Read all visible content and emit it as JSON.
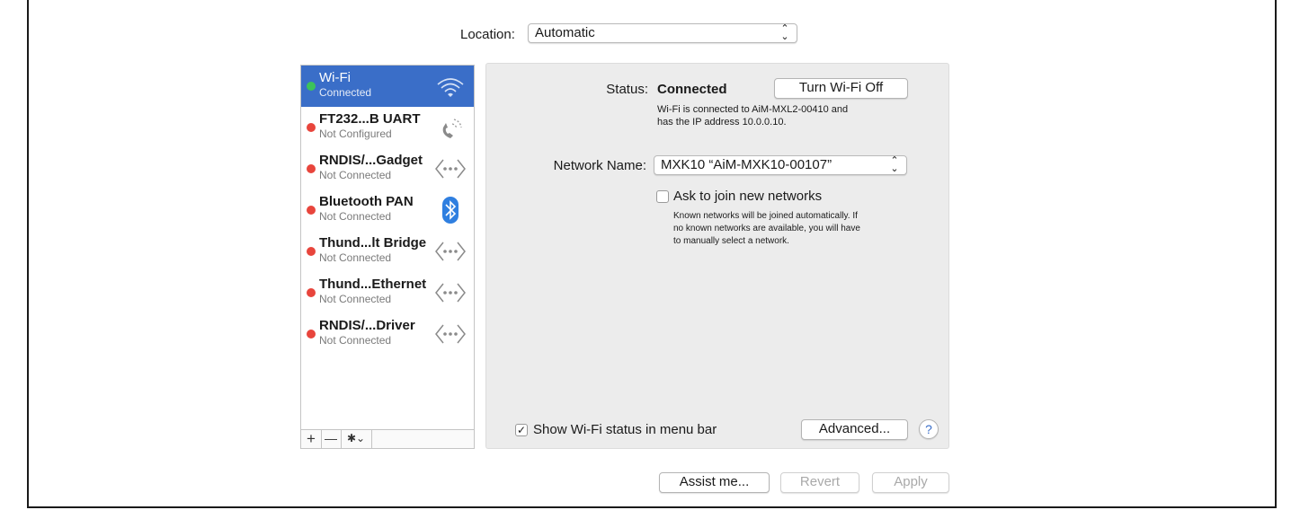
{
  "location": {
    "label": "Location:",
    "value": "Automatic"
  },
  "services": [
    {
      "name": "Wi-Fi",
      "status": "Connected",
      "dot_color": "#3cc35a",
      "icon": "wifi-icon",
      "selected": true
    },
    {
      "name": "FT232...B UART",
      "status": "Not Configured",
      "dot_color": "#e8453c",
      "icon": "phone-icon"
    },
    {
      "name": "RNDIS/...Gadget",
      "status": "Not Connected",
      "dot_color": "#e8453c",
      "icon": "ethernet-icon"
    },
    {
      "name": "Bluetooth PAN",
      "status": "Not Connected",
      "dot_color": "#e8453c",
      "icon": "bluetooth-icon"
    },
    {
      "name": "Thund...lt Bridge",
      "status": "Not Connected",
      "dot_color": "#e8453c",
      "icon": "ethernet-icon"
    },
    {
      "name": "Thund...Ethernet",
      "status": "Not Connected",
      "dot_color": "#e8453c",
      "icon": "ethernet-icon"
    },
    {
      "name": "RNDIS/...Driver",
      "status": "Not Connected",
      "dot_color": "#e8453c",
      "icon": "ethernet-icon"
    }
  ],
  "toolbar": {
    "add": "+",
    "remove": "—",
    "gear": "✱⌄"
  },
  "detail": {
    "status_label": "Status:",
    "status_value": "Connected",
    "turn_off_button": "Turn Wi-Fi Off",
    "status_desc_1": "Wi-Fi is connected to AiM-MXL2-00410 and",
    "status_desc_2": "has the IP address 10.0.0.10.",
    "network_label": "Network Name:",
    "network_value": "MXK10 “AiM-MXK10-00107”",
    "ask_join_label": "Ask to join new networks",
    "ask_join_checked": false,
    "ask_desc_1": "Known networks will be joined automatically. If",
    "ask_desc_2": "no known networks are available, you will have",
    "ask_desc_3": "to manually select a network.",
    "show_status_label": "Show Wi-Fi status in menu bar",
    "show_status_checked": true,
    "advanced_button": "Advanced...",
    "help_button": "?"
  },
  "footer": {
    "assist": "Assist me...",
    "revert": "Revert",
    "apply": "Apply"
  },
  "colors": {
    "selection": "#3a6ec8",
    "connected": "#3cc35a",
    "disconnected": "#e8453c",
    "bluetooth": "#2f7fe0"
  }
}
